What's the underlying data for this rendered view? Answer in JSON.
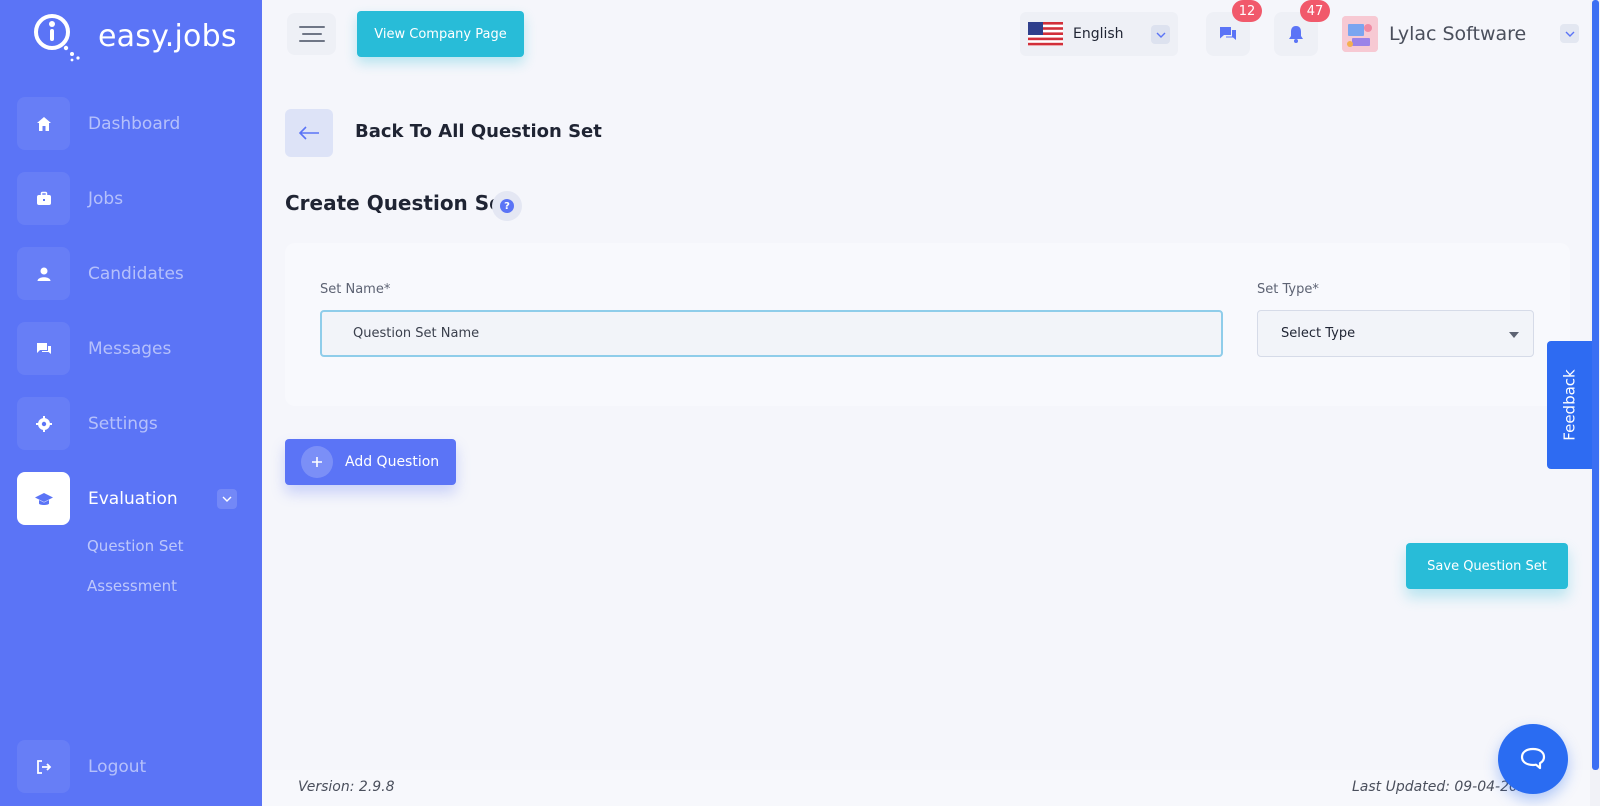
{
  "brand": {
    "name": "easy.jobs"
  },
  "sidebar": {
    "items": [
      {
        "label": "Dashboard",
        "icon": "home-icon"
      },
      {
        "label": "Jobs",
        "icon": "briefcase-icon"
      },
      {
        "label": "Candidates",
        "icon": "user-icon"
      },
      {
        "label": "Messages",
        "icon": "chat-icon"
      },
      {
        "label": "Settings",
        "icon": "gear-icon"
      },
      {
        "label": "Evaluation",
        "icon": "graduation-cap-icon",
        "active": true
      }
    ],
    "evaluation_sub": [
      "Question Set",
      "Assessment"
    ],
    "logout": "Logout"
  },
  "topbar": {
    "company_page_button": "View Company Page",
    "language": "English",
    "messages_badge": "12",
    "notifications_badge": "47",
    "company_name": "Lylac Software"
  },
  "page": {
    "back_label": "Back To All Question Set",
    "title": "Create Question Set"
  },
  "form": {
    "set_name_label": "Set Name*",
    "set_name_placeholder": "Question Set Name",
    "set_type_label": "Set Type*",
    "set_type_value": "Select Type"
  },
  "actions": {
    "add_question": "Add Question",
    "save_question_set": "Save Question Set"
  },
  "feedback_tab": "Feedback",
  "footer": {
    "version": "Version: 2.9.8",
    "last_updated": "Last Updated: 09-04-2024"
  },
  "colors": {
    "sidebar": "#5b74f6",
    "accent_cyan": "#28bcd8",
    "badge_red": "#f1596b",
    "feedback_blue": "#2e6bf2"
  }
}
